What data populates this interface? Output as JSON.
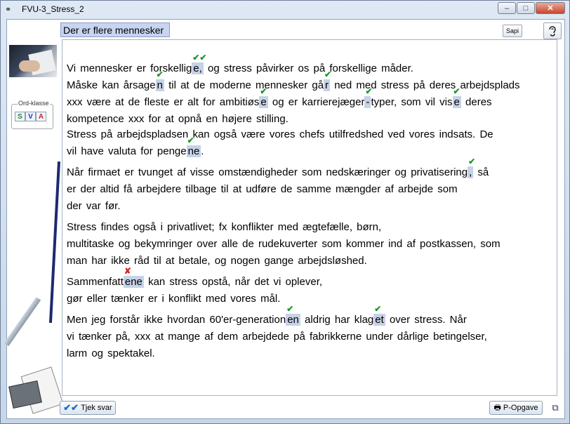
{
  "window": {
    "title": "FVU-3_Stress_2",
    "icon": "app-icon",
    "controls": [
      "–",
      "□",
      "✕"
    ]
  },
  "header": {
    "title": "Der er flere mennesker",
    "sapi_label": "Sapi",
    "ear_icon": "ear-icon"
  },
  "sidebar": {
    "ordklasse_label": "Ord-klasse",
    "buttons": [
      "S",
      "V",
      "A"
    ]
  },
  "text": {
    "p1": [
      [
        "Vi mennesker er forskellig",
        {
          "blank": "e,",
          "mark": "✔✔"
        },
        " og stress påvirker os på forskellige måder."
      ],
      [
        "Måske kan årsage",
        {
          "blank": "n",
          "mark": "✔"
        },
        " til at de moderne mennesker gå",
        {
          "blank": "r",
          "mark": "✔"
        },
        " ned med stress på deres arbejdsplads"
      ],
      [
        " xxx være at de fleste er alt for ambitiøs",
        {
          "blank": "e",
          "mark": "✔"
        },
        " og er karrierejæger",
        {
          "blank": "-",
          "mark": "✔"
        },
        "typer, som vil vis",
        {
          "blank": "e",
          "mark": "✔"
        },
        " deres"
      ],
      [
        " kompetence xxx for at opnå en højere stilling."
      ]
    ],
    "p2": [
      [
        "Stress på arbejdspladsen kan også være vores chefs utilfredshed ved vores indsats. De"
      ],
      [
        " vil have valuta for penge",
        {
          "blank": "ne",
          "mark": "✔"
        },
        "."
      ]
    ],
    "p3": [
      [
        "Når firmaet er tvunget af visse omstændigheder som nedskæringer og privatisering",
        {
          "blank": ",",
          "mark": "✔"
        },
        " så"
      ],
      [
        " er der altid få arbejdere tilbage til at udføre de samme mængder af arbejde som"
      ],
      [
        "der var før."
      ]
    ],
    "p4": [
      [
        "Stress findes også i privatlivet; fx konflikter med ægtefælle, børn,"
      ],
      [
        "multitaske og bekymringer over alle de rudekuverter som kommer ind af postkassen, som"
      ],
      [
        " man har ikke råd til at betale, og nogen gange arbejdsløshed."
      ]
    ],
    "p5": [
      [
        "Sammenfatt",
        {
          "blank": "ene",
          "mark": "✘",
          "bad": true
        },
        " kan stress opstå, når det vi oplever,"
      ],
      [
        "gør eller tænker er i konflikt med vores mål."
      ]
    ],
    "p6": [
      [
        "Men jeg forstår ikke hvordan 60'er-generation",
        {
          "blank": "en",
          "mark": "✔"
        },
        " aldrig har klag",
        {
          "blank": "et",
          "mark": "✔"
        },
        " over stress. Når"
      ],
      [
        " vi tænker på, xxx at mange af dem arbejdede på fabrikkerne under dårlige betingelser,"
      ],
      [
        " larm og spektakel."
      ]
    ]
  },
  "footer": {
    "check_label": "Tjek svar",
    "popgave_label": "P-Opgave"
  }
}
